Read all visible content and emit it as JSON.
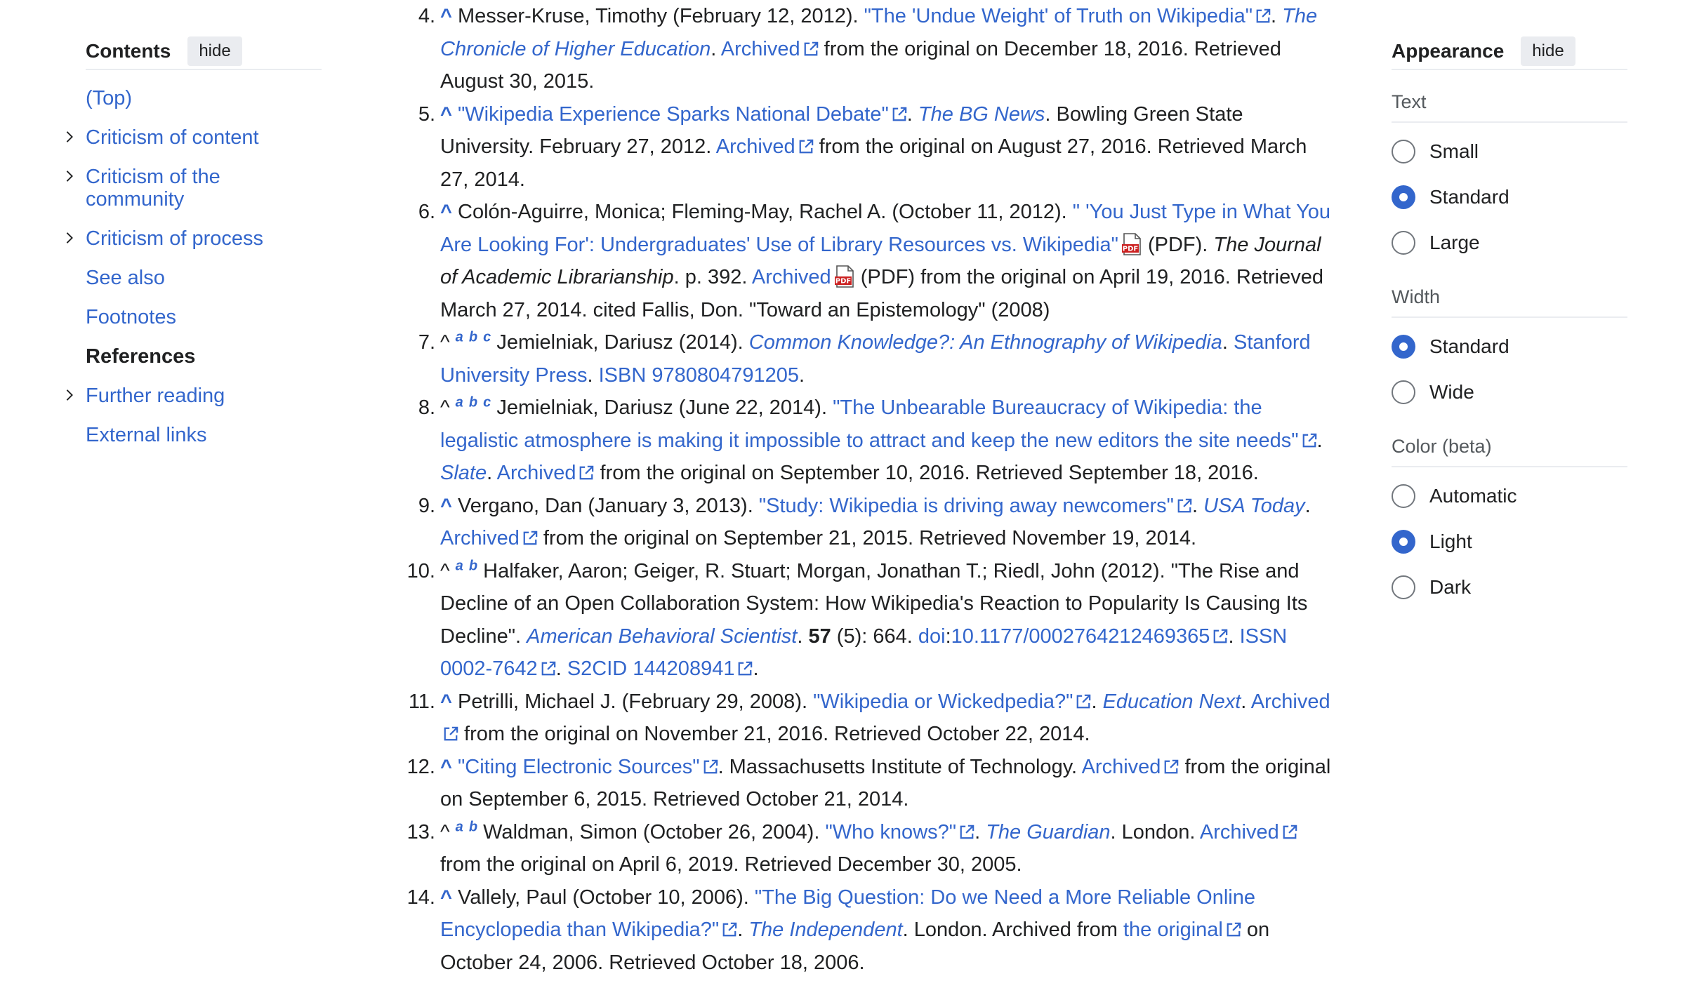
{
  "toc": {
    "title": "Contents",
    "hide_label": "hide",
    "items": [
      {
        "label": "(Top)",
        "expandable": false,
        "active": false
      },
      {
        "label": "Criticism of content",
        "expandable": true,
        "active": false
      },
      {
        "label": "Criticism of the community",
        "expandable": true,
        "active": false
      },
      {
        "label": "Criticism of process",
        "expandable": true,
        "active": false
      },
      {
        "label": "See also",
        "expandable": false,
        "active": false
      },
      {
        "label": "Footnotes",
        "expandable": false,
        "active": false
      },
      {
        "label": "References",
        "expandable": false,
        "active": true
      },
      {
        "label": "Further reading",
        "expandable": true,
        "active": false
      },
      {
        "label": "External links",
        "expandable": false,
        "active": false
      }
    ]
  },
  "appearance": {
    "title": "Appearance",
    "hide_label": "hide",
    "sections": [
      {
        "label": "Text",
        "options": [
          {
            "label": "Small",
            "selected": false
          },
          {
            "label": "Standard",
            "selected": true
          },
          {
            "label": "Large",
            "selected": false
          }
        ]
      },
      {
        "label": "Width",
        "options": [
          {
            "label": "Standard",
            "selected": true
          },
          {
            "label": "Wide",
            "selected": false
          }
        ]
      },
      {
        "label": "Color (beta)",
        "options": [
          {
            "label": "Automatic",
            "selected": false
          },
          {
            "label": "Light",
            "selected": true
          },
          {
            "label": "Dark",
            "selected": false
          }
        ]
      }
    ]
  },
  "references": [
    {
      "num": "4.",
      "caret_link": true,
      "segments": [
        {
          "t": "Messer-Kruse, Timothy (February 12, 2012). "
        },
        {
          "t": "\"The 'Undue Weight' of Truth on Wikipedia\"",
          "link": true,
          "ext": true
        },
        {
          "t": ". "
        },
        {
          "t": "The Chronicle of Higher Education",
          "link": true,
          "italic": true
        },
        {
          "t": ". "
        },
        {
          "t": "Archived",
          "link": true,
          "ext": true
        },
        {
          "t": " from the original on December 18, 2016. Retrieved August 30, 2015."
        }
      ]
    },
    {
      "num": "5.",
      "caret_link": true,
      "segments": [
        {
          "t": "\"Wikipedia Experience Sparks National Debate\"",
          "link": true,
          "ext": true
        },
        {
          "t": ". "
        },
        {
          "t": "The BG News",
          "link": true,
          "italic": true
        },
        {
          "t": ". Bowling Green State University. February 27, 2012. "
        },
        {
          "t": "Archived",
          "link": true,
          "ext": true
        },
        {
          "t": " from the original on August 27, 2016. Retrieved March 27, 2014."
        }
      ]
    },
    {
      "num": "6.",
      "caret_link": true,
      "segments": [
        {
          "t": "Colón-Aguirre, Monica; Fleming-May, Rachel A. (October 11, 2012). "
        },
        {
          "t": "\" 'You Just Type in What You Are Looking For': Undergraduates' Use of Library Resources vs. Wikipedia\"",
          "link": true,
          "pdf": true
        },
        {
          "t": " (PDF). "
        },
        {
          "t": "The Journal of Academic Librarianship",
          "italic": true
        },
        {
          "t": ". p. 392. "
        },
        {
          "t": "Archived",
          "link": true,
          "pdf": true
        },
        {
          "t": " (PDF) from the original on April 19, 2016. Retrieved March 27, 2014. cited Fallis, Don. \"Toward an Epistemology\" (2008)"
        }
      ]
    },
    {
      "num": "7.",
      "caret_link": false,
      "backlinks": [
        "a",
        "b",
        "c"
      ],
      "segments": [
        {
          "t": "Jemielniak, Dariusz (2014). "
        },
        {
          "t": "Common Knowledge?: An Ethnography of Wikipedia",
          "link": true,
          "italic": true
        },
        {
          "t": ". "
        },
        {
          "t": "Stanford University Press",
          "link": true
        },
        {
          "t": ". "
        },
        {
          "t": "ISBN",
          "link": true
        },
        {
          "t": " "
        },
        {
          "t": "9780804791205",
          "link": true
        },
        {
          "t": "."
        }
      ]
    },
    {
      "num": "8.",
      "caret_link": false,
      "backlinks": [
        "a",
        "b",
        "c"
      ],
      "segments": [
        {
          "t": "Jemielniak, Dariusz (June 22, 2014). "
        },
        {
          "t": "\"The Unbearable Bureaucracy of Wikipedia: the legalistic atmosphere is making it impossible to attract and keep the new editors the site needs\"",
          "link": true,
          "ext": true
        },
        {
          "t": ". "
        },
        {
          "t": "Slate",
          "link": true,
          "italic": true
        },
        {
          "t": ". "
        },
        {
          "t": "Archived",
          "link": true,
          "ext": true
        },
        {
          "t": " from the original on September 10, 2016. Retrieved September 18, 2016."
        }
      ]
    },
    {
      "num": "9.",
      "caret_link": true,
      "segments": [
        {
          "t": "Vergano, Dan (January 3, 2013). "
        },
        {
          "t": "\"Study: Wikipedia is driving away newcomers\"",
          "link": true,
          "ext": true
        },
        {
          "t": ". "
        },
        {
          "t": "USA Today",
          "link": true,
          "italic": true
        },
        {
          "t": ". "
        },
        {
          "t": "Archived",
          "link": true,
          "ext": true
        },
        {
          "t": " from the original on September 21, 2015. Retrieved November 19, 2014."
        }
      ]
    },
    {
      "num": "10.",
      "caret_link": false,
      "backlinks": [
        "a",
        "b"
      ],
      "segments": [
        {
          "t": "Halfaker, Aaron; Geiger, R. Stuart; Morgan, Jonathan T.; Riedl, John (2012). \"The Rise and Decline of an Open Collaboration System: How Wikipedia's Reaction to Popularity Is Causing Its Decline\". "
        },
        {
          "t": "American Behavioral Scientist",
          "link": true,
          "italic": true
        },
        {
          "t": ". "
        },
        {
          "t": "57",
          "bold": true
        },
        {
          "t": " (5): 664. "
        },
        {
          "t": "doi",
          "link": true
        },
        {
          "t": ":"
        },
        {
          "t": "10.1177/0002764212469365",
          "link": true,
          "ext": true
        },
        {
          "t": ". "
        },
        {
          "t": "ISSN",
          "link": true
        },
        {
          "t": " "
        },
        {
          "t": "0002-7642",
          "link": true,
          "ext": true
        },
        {
          "t": ". "
        },
        {
          "t": "S2CID",
          "link": true
        },
        {
          "t": " "
        },
        {
          "t": "144208941",
          "link": true,
          "ext": true
        },
        {
          "t": "."
        }
      ]
    },
    {
      "num": "11.",
      "caret_link": true,
      "segments": [
        {
          "t": "Petrilli, Michael J. (February 29, 2008). "
        },
        {
          "t": "\"Wikipedia or Wickedpedia?\"",
          "link": true,
          "ext": true
        },
        {
          "t": ". "
        },
        {
          "t": "Education Next",
          "link": true,
          "italic": true
        },
        {
          "t": ". "
        },
        {
          "t": "Archived",
          "link": true,
          "ext": true
        },
        {
          "t": " from the original on November 21, 2016. Retrieved October 22, 2014."
        }
      ]
    },
    {
      "num": "12.",
      "caret_link": true,
      "segments": [
        {
          "t": "\"Citing Electronic Sources\"",
          "link": true,
          "ext": true
        },
        {
          "t": ". Massachusetts Institute of Technology. "
        },
        {
          "t": "Archived",
          "link": true,
          "ext": true
        },
        {
          "t": " from the original on September 6, 2015. Retrieved October 21, 2014."
        }
      ]
    },
    {
      "num": "13.",
      "caret_link": false,
      "backlinks": [
        "a",
        "b"
      ],
      "segments": [
        {
          "t": "Waldman, Simon (October 26, 2004). "
        },
        {
          "t": "\"Who knows?\"",
          "link": true,
          "ext": true
        },
        {
          "t": ". "
        },
        {
          "t": "The Guardian",
          "link": true,
          "italic": true
        },
        {
          "t": ". London. "
        },
        {
          "t": "Archived",
          "link": true,
          "ext": true
        },
        {
          "t": " from the original on April 6, 2019. Retrieved December 30, 2005."
        }
      ]
    },
    {
      "num": "14.",
      "caret_link": true,
      "segments": [
        {
          "t": "Vallely, Paul (October 10, 2006). "
        },
        {
          "t": "\"The Big Question: Do we Need a More Reliable Online Encyclopedia than Wikipedia?\"",
          "link": true,
          "ext": true
        },
        {
          "t": ". "
        },
        {
          "t": "The Independent",
          "link": true,
          "italic": true
        },
        {
          "t": ". London. Archived from "
        },
        {
          "t": "the original",
          "link": true,
          "ext": true
        },
        {
          "t": " on October 24, 2006. Retrieved October 18, 2006."
        }
      ]
    }
  ]
}
